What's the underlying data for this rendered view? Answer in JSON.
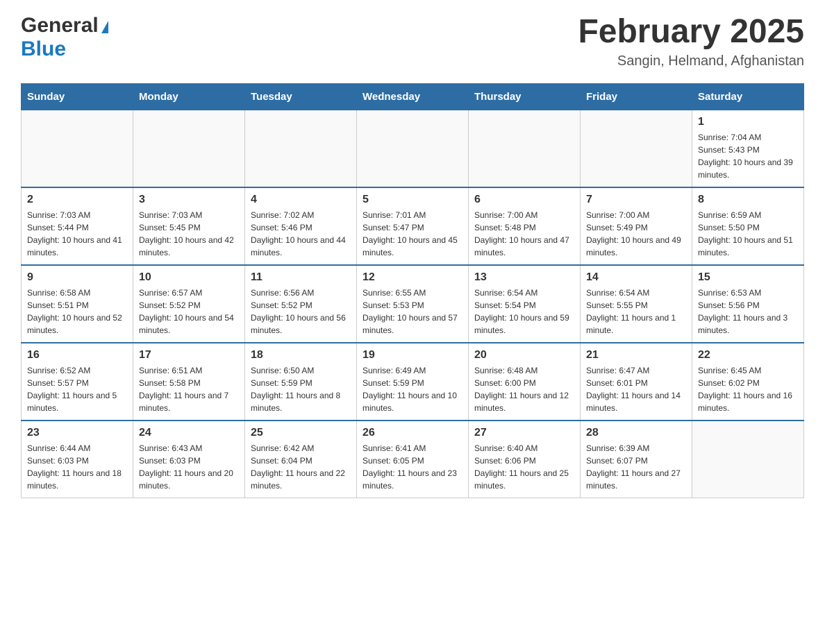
{
  "header": {
    "logo_general": "General",
    "logo_blue": "Blue",
    "month_title": "February 2025",
    "location": "Sangin, Helmand, Afghanistan"
  },
  "weekdays": [
    "Sunday",
    "Monday",
    "Tuesday",
    "Wednesday",
    "Thursday",
    "Friday",
    "Saturday"
  ],
  "weeks": [
    [
      {
        "day": "",
        "info": ""
      },
      {
        "day": "",
        "info": ""
      },
      {
        "day": "",
        "info": ""
      },
      {
        "day": "",
        "info": ""
      },
      {
        "day": "",
        "info": ""
      },
      {
        "day": "",
        "info": ""
      },
      {
        "day": "1",
        "info": "Sunrise: 7:04 AM\nSunset: 5:43 PM\nDaylight: 10 hours and 39 minutes."
      }
    ],
    [
      {
        "day": "2",
        "info": "Sunrise: 7:03 AM\nSunset: 5:44 PM\nDaylight: 10 hours and 41 minutes."
      },
      {
        "day": "3",
        "info": "Sunrise: 7:03 AM\nSunset: 5:45 PM\nDaylight: 10 hours and 42 minutes."
      },
      {
        "day": "4",
        "info": "Sunrise: 7:02 AM\nSunset: 5:46 PM\nDaylight: 10 hours and 44 minutes."
      },
      {
        "day": "5",
        "info": "Sunrise: 7:01 AM\nSunset: 5:47 PM\nDaylight: 10 hours and 45 minutes."
      },
      {
        "day": "6",
        "info": "Sunrise: 7:00 AM\nSunset: 5:48 PM\nDaylight: 10 hours and 47 minutes."
      },
      {
        "day": "7",
        "info": "Sunrise: 7:00 AM\nSunset: 5:49 PM\nDaylight: 10 hours and 49 minutes."
      },
      {
        "day": "8",
        "info": "Sunrise: 6:59 AM\nSunset: 5:50 PM\nDaylight: 10 hours and 51 minutes."
      }
    ],
    [
      {
        "day": "9",
        "info": "Sunrise: 6:58 AM\nSunset: 5:51 PM\nDaylight: 10 hours and 52 minutes."
      },
      {
        "day": "10",
        "info": "Sunrise: 6:57 AM\nSunset: 5:52 PM\nDaylight: 10 hours and 54 minutes."
      },
      {
        "day": "11",
        "info": "Sunrise: 6:56 AM\nSunset: 5:52 PM\nDaylight: 10 hours and 56 minutes."
      },
      {
        "day": "12",
        "info": "Sunrise: 6:55 AM\nSunset: 5:53 PM\nDaylight: 10 hours and 57 minutes."
      },
      {
        "day": "13",
        "info": "Sunrise: 6:54 AM\nSunset: 5:54 PM\nDaylight: 10 hours and 59 minutes."
      },
      {
        "day": "14",
        "info": "Sunrise: 6:54 AM\nSunset: 5:55 PM\nDaylight: 11 hours and 1 minute."
      },
      {
        "day": "15",
        "info": "Sunrise: 6:53 AM\nSunset: 5:56 PM\nDaylight: 11 hours and 3 minutes."
      }
    ],
    [
      {
        "day": "16",
        "info": "Sunrise: 6:52 AM\nSunset: 5:57 PM\nDaylight: 11 hours and 5 minutes."
      },
      {
        "day": "17",
        "info": "Sunrise: 6:51 AM\nSunset: 5:58 PM\nDaylight: 11 hours and 7 minutes."
      },
      {
        "day": "18",
        "info": "Sunrise: 6:50 AM\nSunset: 5:59 PM\nDaylight: 11 hours and 8 minutes."
      },
      {
        "day": "19",
        "info": "Sunrise: 6:49 AM\nSunset: 5:59 PM\nDaylight: 11 hours and 10 minutes."
      },
      {
        "day": "20",
        "info": "Sunrise: 6:48 AM\nSunset: 6:00 PM\nDaylight: 11 hours and 12 minutes."
      },
      {
        "day": "21",
        "info": "Sunrise: 6:47 AM\nSunset: 6:01 PM\nDaylight: 11 hours and 14 minutes."
      },
      {
        "day": "22",
        "info": "Sunrise: 6:45 AM\nSunset: 6:02 PM\nDaylight: 11 hours and 16 minutes."
      }
    ],
    [
      {
        "day": "23",
        "info": "Sunrise: 6:44 AM\nSunset: 6:03 PM\nDaylight: 11 hours and 18 minutes."
      },
      {
        "day": "24",
        "info": "Sunrise: 6:43 AM\nSunset: 6:03 PM\nDaylight: 11 hours and 20 minutes."
      },
      {
        "day": "25",
        "info": "Sunrise: 6:42 AM\nSunset: 6:04 PM\nDaylight: 11 hours and 22 minutes."
      },
      {
        "day": "26",
        "info": "Sunrise: 6:41 AM\nSunset: 6:05 PM\nDaylight: 11 hours and 23 minutes."
      },
      {
        "day": "27",
        "info": "Sunrise: 6:40 AM\nSunset: 6:06 PM\nDaylight: 11 hours and 25 minutes."
      },
      {
        "day": "28",
        "info": "Sunrise: 6:39 AM\nSunset: 6:07 PM\nDaylight: 11 hours and 27 minutes."
      },
      {
        "day": "",
        "info": ""
      }
    ]
  ]
}
